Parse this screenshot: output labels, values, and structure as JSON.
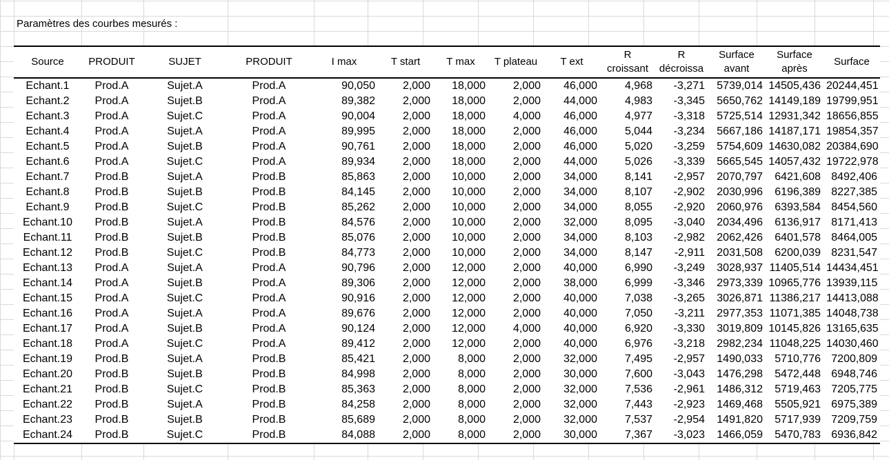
{
  "sheet": {
    "title": "Paramètres des courbes mesurés :"
  },
  "table": {
    "headers": [
      [
        "Source"
      ],
      [
        "PRODUIT"
      ],
      [
        "SUJET"
      ],
      [
        "PRODUIT"
      ],
      [
        "I max"
      ],
      [
        "T start"
      ],
      [
        "T max"
      ],
      [
        "T plateau"
      ],
      [
        "T ext"
      ],
      [
        "R",
        "croissant"
      ],
      [
        "R",
        "décroissa"
      ],
      [
        "Surface",
        "avant"
      ],
      [
        "Surface",
        "après"
      ],
      [
        "Surface"
      ]
    ],
    "rows": [
      [
        "Echant.1",
        "Prod.A",
        "Sujet.A",
        "Prod.A",
        "90,050",
        "2,000",
        "18,000",
        "2,000",
        "46,000",
        "4,968",
        "-3,271",
        "5739,014",
        "14505,436",
        "20244,451"
      ],
      [
        "Echant.2",
        "Prod.A",
        "Sujet.B",
        "Prod.A",
        "89,382",
        "2,000",
        "18,000",
        "2,000",
        "44,000",
        "4,983",
        "-3,345",
        "5650,762",
        "14149,189",
        "19799,951"
      ],
      [
        "Echant.3",
        "Prod.A",
        "Sujet.C",
        "Prod.A",
        "90,004",
        "2,000",
        "18,000",
        "4,000",
        "46,000",
        "4,977",
        "-3,318",
        "5725,514",
        "12931,342",
        "18656,855"
      ],
      [
        "Echant.4",
        "Prod.A",
        "Sujet.A",
        "Prod.A",
        "89,995",
        "2,000",
        "18,000",
        "2,000",
        "46,000",
        "5,044",
        "-3,234",
        "5667,186",
        "14187,171",
        "19854,357"
      ],
      [
        "Echant.5",
        "Prod.A",
        "Sujet.B",
        "Prod.A",
        "90,761",
        "2,000",
        "18,000",
        "2,000",
        "46,000",
        "5,020",
        "-3,259",
        "5754,609",
        "14630,082",
        "20384,690"
      ],
      [
        "Echant.6",
        "Prod.A",
        "Sujet.C",
        "Prod.A",
        "89,934",
        "2,000",
        "18,000",
        "2,000",
        "44,000",
        "5,026",
        "-3,339",
        "5665,545",
        "14057,432",
        "19722,978"
      ],
      [
        "Echant.7",
        "Prod.B",
        "Sujet.A",
        "Prod.B",
        "85,863",
        "2,000",
        "10,000",
        "2,000",
        "34,000",
        "8,141",
        "-2,957",
        "2070,797",
        "6421,608",
        "8492,406"
      ],
      [
        "Echant.8",
        "Prod.B",
        "Sujet.B",
        "Prod.B",
        "84,145",
        "2,000",
        "10,000",
        "2,000",
        "34,000",
        "8,107",
        "-2,902",
        "2030,996",
        "6196,389",
        "8227,385"
      ],
      [
        "Echant.9",
        "Prod.B",
        "Sujet.C",
        "Prod.B",
        "85,262",
        "2,000",
        "10,000",
        "2,000",
        "34,000",
        "8,055",
        "-2,920",
        "2060,976",
        "6393,584",
        "8454,560"
      ],
      [
        "Echant.10",
        "Prod.B",
        "Sujet.A",
        "Prod.B",
        "84,576",
        "2,000",
        "10,000",
        "2,000",
        "32,000",
        "8,095",
        "-3,040",
        "2034,496",
        "6136,917",
        "8171,413"
      ],
      [
        "Echant.11",
        "Prod.B",
        "Sujet.B",
        "Prod.B",
        "85,076",
        "2,000",
        "10,000",
        "2,000",
        "34,000",
        "8,103",
        "-2,982",
        "2062,426",
        "6401,578",
        "8464,005"
      ],
      [
        "Echant.12",
        "Prod.B",
        "Sujet.C",
        "Prod.B",
        "84,773",
        "2,000",
        "10,000",
        "2,000",
        "34,000",
        "8,147",
        "-2,911",
        "2031,508",
        "6200,039",
        "8231,547"
      ],
      [
        "Echant.13",
        "Prod.A",
        "Sujet.A",
        "Prod.A",
        "90,796",
        "2,000",
        "12,000",
        "2,000",
        "40,000",
        "6,990",
        "-3,249",
        "3028,937",
        "11405,514",
        "14434,451"
      ],
      [
        "Echant.14",
        "Prod.A",
        "Sujet.B",
        "Prod.A",
        "89,306",
        "2,000",
        "12,000",
        "2,000",
        "38,000",
        "6,999",
        "-3,346",
        "2973,339",
        "10965,776",
        "13939,115"
      ],
      [
        "Echant.15",
        "Prod.A",
        "Sujet.C",
        "Prod.A",
        "90,916",
        "2,000",
        "12,000",
        "2,000",
        "40,000",
        "7,038",
        "-3,265",
        "3026,871",
        "11386,217",
        "14413,088"
      ],
      [
        "Echant.16",
        "Prod.A",
        "Sujet.A",
        "Prod.A",
        "89,676",
        "2,000",
        "12,000",
        "2,000",
        "40,000",
        "7,050",
        "-3,211",
        "2977,353",
        "11071,385",
        "14048,738"
      ],
      [
        "Echant.17",
        "Prod.A",
        "Sujet.B",
        "Prod.A",
        "90,124",
        "2,000",
        "12,000",
        "4,000",
        "40,000",
        "6,920",
        "-3,330",
        "3019,809",
        "10145,826",
        "13165,635"
      ],
      [
        "Echant.18",
        "Prod.A",
        "Sujet.C",
        "Prod.A",
        "89,412",
        "2,000",
        "12,000",
        "2,000",
        "40,000",
        "6,976",
        "-3,218",
        "2982,234",
        "11048,225",
        "14030,460"
      ],
      [
        "Echant.19",
        "Prod.B",
        "Sujet.A",
        "Prod.B",
        "85,421",
        "2,000",
        "8,000",
        "2,000",
        "32,000",
        "7,495",
        "-2,957",
        "1490,033",
        "5710,776",
        "7200,809"
      ],
      [
        "Echant.20",
        "Prod.B",
        "Sujet.B",
        "Prod.B",
        "84,998",
        "2,000",
        "8,000",
        "2,000",
        "30,000",
        "7,600",
        "-3,043",
        "1476,298",
        "5472,448",
        "6948,746"
      ],
      [
        "Echant.21",
        "Prod.B",
        "Sujet.C",
        "Prod.B",
        "85,363",
        "2,000",
        "8,000",
        "2,000",
        "32,000",
        "7,536",
        "-2,961",
        "1486,312",
        "5719,463",
        "7205,775"
      ],
      [
        "Echant.22",
        "Prod.B",
        "Sujet.A",
        "Prod.B",
        "84,258",
        "2,000",
        "8,000",
        "2,000",
        "32,000",
        "7,443",
        "-2,923",
        "1469,468",
        "5505,921",
        "6975,389"
      ],
      [
        "Echant.23",
        "Prod.B",
        "Sujet.B",
        "Prod.B",
        "85,689",
        "2,000",
        "8,000",
        "2,000",
        "32,000",
        "7,537",
        "-2,954",
        "1491,820",
        "5717,939",
        "7209,759"
      ],
      [
        "Echant.24",
        "Prod.B",
        "Sujet.C",
        "Prod.B",
        "84,088",
        "2,000",
        "8,000",
        "2,000",
        "30,000",
        "7,367",
        "-3,023",
        "1466,059",
        "5470,783",
        "6936,842"
      ]
    ]
  }
}
